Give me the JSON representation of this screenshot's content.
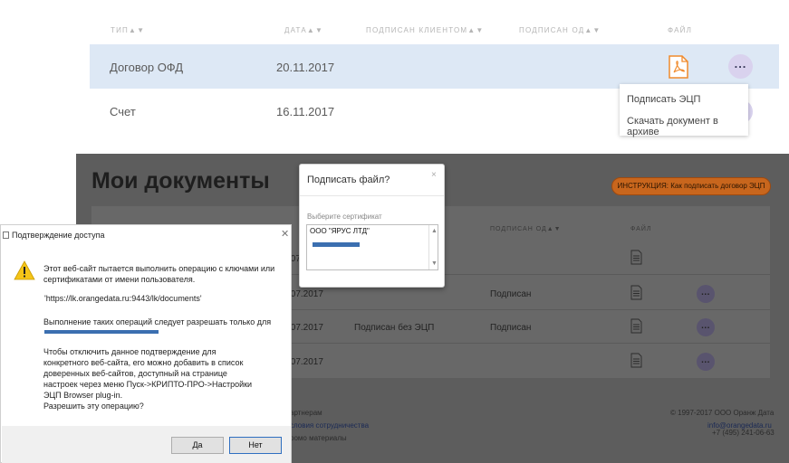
{
  "top": {
    "headers": {
      "type": "ТИП▲▼",
      "date": "ДАТА▲▼",
      "signed_client": "ПОДПИСАН КЛИЕНТОМ▲▼",
      "signed_od": "ПОДПИСАН ОД▲▼",
      "file": "ФАЙЛ"
    },
    "rows": [
      {
        "type": "Договор ОФД",
        "date": "20.11.2017"
      },
      {
        "type": "Счет",
        "date": "16.11.2017"
      }
    ],
    "more_label": "...",
    "menu": {
      "sign": "Подписать ЭЦП",
      "download": "Скачать документ в архиве"
    },
    "colors": {
      "selected_row": "#dde8f5",
      "pdf": "#f08a2c",
      "more_button": "#d9d2ee"
    }
  },
  "dark": {
    "title": "Мои документы",
    "instruction": "ИНСТРУКЦИЯ: Как подписать договор ЭЦП",
    "headers": {
      "signed_od": "ПОДПИСАН ОД▲▼",
      "file": "ФАЙЛ"
    },
    "rows": [
      {
        "date": ".07.2017",
        "client": "",
        "od": ""
      },
      {
        "date": ".07.2017",
        "client": "",
        "od": "Подписан"
      },
      {
        "date": ".07.2017",
        "client": "Подписан без ЭЦП",
        "od": "Подписан"
      },
      {
        "date": ".07.2017",
        "client": "",
        "od": ""
      }
    ],
    "footer": {
      "partners": "артнерам",
      "terms": "словия сотрудничества",
      "promo": "ромо материалы",
      "copyright": "© 1997-2017 ООО Оранж Дата",
      "email": "info@orangedata.ru",
      "phone": "+7 (495) 241-06-63"
    }
  },
  "sign_dialog": {
    "title": "Подписать файл?",
    "close": "×",
    "label": "Выберите сертификат",
    "option": "ООО \"ЯРУС ЛТД\""
  },
  "confirm_dialog": {
    "title": "Подтверждение доступа",
    "close": "✕",
    "text1": "Этот веб-сайт пытается выполнить операцию с ключами или сертификатами от имени пользователя.",
    "url": "'https://lk.orangedata.ru:9443/lk/documents'",
    "text2": "Выполнение таких операций следует разрешать только для",
    "text3": "Чтобы отключить данное подтверждение для конкретного веб-сайта, его можно добавить в список доверенных веб-сайтов, доступный на странице настроек через меню Пуск->КРИПТО-ПРО->Настройки ЭЦП Browser plug-in.",
    "question": "Разрешить эту операцию?",
    "yes": "Да",
    "no": "Нет"
  }
}
